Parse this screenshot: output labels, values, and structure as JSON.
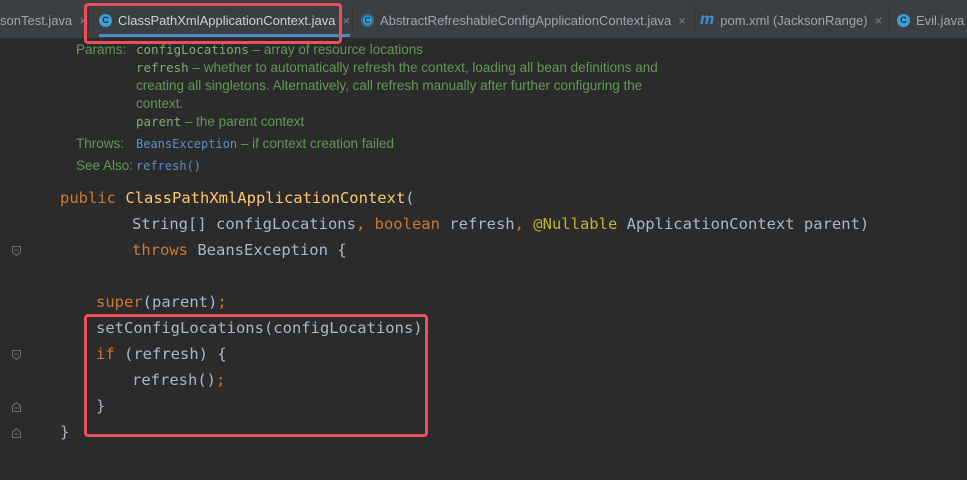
{
  "tabs": [
    {
      "label": "sonTest.java",
      "icon": "none"
    },
    {
      "label": "ClassPathXmlApplicationContext.java",
      "icon": "class-icon"
    },
    {
      "label": "AbstractRefreshableConfigApplicationContext.java",
      "icon": "abstract-class-icon"
    },
    {
      "label": "pom.xml (JacksonRange)",
      "icon": "maven-icon"
    },
    {
      "label": "Evil.java",
      "icon": "class-icon"
    }
  ],
  "close_glyph": "×",
  "doc": {
    "params_key": "Params:",
    "p1_name": "configLocations",
    "p1_desc": " – array of resource locations",
    "p2_name": "refresh",
    "p2_desc": " – whether to automatically refresh the context, loading all bean definitions and",
    "p2_desc2": "creating all singletons. Alternatively, call refresh manually after further configuring the",
    "p2_desc3": "context.",
    "p3_name": "parent",
    "p3_desc": " – the parent context",
    "throws_key": "Throws:",
    "throws_name": "BeansException",
    "throws_desc": " – if context creation failed",
    "see_key": "See Also:",
    "see_name": "refresh()"
  },
  "code": {
    "l1_kw": "public ",
    "l1_fn": "ClassPathXmlApplicationContext",
    "l1_rest": "(",
    "l2_a": "String[] configLocations",
    "l2_comma1": ", ",
    "l2_kw": "boolean ",
    "l2_b": "refresh",
    "l2_comma2": ", ",
    "l2_ann": "@Nullable ",
    "l2_c": "ApplicationContext parent)",
    "l3_kw": "throws ",
    "l3_rest": "BeansException {",
    "l4_kw": "super",
    "l4_rest": "(parent)",
    "l4_semi": ";",
    "l5_rest": "setConfigLocations(configLocations)",
    "l5_semi": ";",
    "l6_kw": "if ",
    "l6_rest": "(refresh) {",
    "l7_rest": "refresh()",
    "l7_semi": ";",
    "l8_rest": "}",
    "l9_rest": "}"
  },
  "colors": {
    "keyword": "#cc7832",
    "method_decl": "#ffc66d",
    "annotation": "#bbb529",
    "doc_comment": "#629755",
    "highlight": "#e8505b"
  }
}
